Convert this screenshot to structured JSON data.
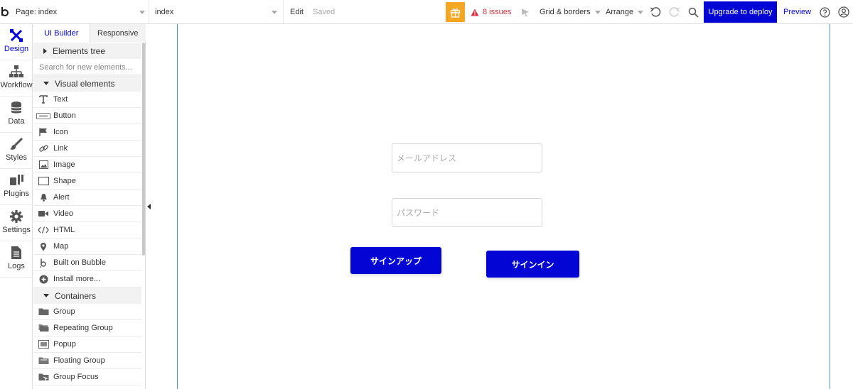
{
  "topbar": {
    "page_label": "Page: index",
    "view_label": "index",
    "edit_label": "Edit",
    "saved_label": "Saved",
    "issues_label": "8 issues",
    "grid_label": "Grid & borders",
    "arrange_label": "Arrange",
    "upgrade_label": "Upgrade to deploy",
    "preview_label": "Preview"
  },
  "rail": {
    "items": [
      {
        "label": "Design"
      },
      {
        "label": "Workflow"
      },
      {
        "label": "Data"
      },
      {
        "label": "Styles"
      },
      {
        "label": "Plugins"
      },
      {
        "label": "Settings"
      },
      {
        "label": "Logs"
      }
    ]
  },
  "palette": {
    "tabs": [
      {
        "label": "UI Builder"
      },
      {
        "label": "Responsive"
      }
    ],
    "elements_tree_label": "Elements tree",
    "search_placeholder": "Search for new elements...",
    "visual_label": "Visual elements",
    "visual_items": [
      {
        "label": "Text",
        "icon": "text-icon"
      },
      {
        "label": "Button",
        "icon": "button-icon"
      },
      {
        "label": "Icon",
        "icon": "flag-icon"
      },
      {
        "label": "Link",
        "icon": "link-icon"
      },
      {
        "label": "Image",
        "icon": "image-icon"
      },
      {
        "label": "Shape",
        "icon": "shape-icon"
      },
      {
        "label": "Alert",
        "icon": "bell-icon"
      },
      {
        "label": "Video",
        "icon": "video-icon"
      },
      {
        "label": "HTML",
        "icon": "code-icon"
      },
      {
        "label": "Map",
        "icon": "map-pin-icon"
      },
      {
        "label": "Built on Bubble",
        "icon": "bubble-logo-icon"
      },
      {
        "label": "Install more...",
        "icon": "plus-circle-icon"
      }
    ],
    "containers_label": "Containers",
    "container_items": [
      {
        "label": "Group",
        "icon": "folder-icon"
      },
      {
        "label": "Repeating Group",
        "icon": "repeating-group-icon"
      },
      {
        "label": "Popup",
        "icon": "popup-icon"
      },
      {
        "label": "Floating Group",
        "icon": "floating-group-icon"
      },
      {
        "label": "Group Focus",
        "icon": "group-focus-icon"
      }
    ]
  },
  "canvas": {
    "email_placeholder": "メールアドレス",
    "password_placeholder": "パスワード",
    "signup_label": "サインアップ",
    "signin_label": "サインイン"
  },
  "colors": {
    "accent": "#0205d3",
    "issues": "#d9303e",
    "gift": "#f5a623",
    "page_border": "#4a90d9"
  }
}
